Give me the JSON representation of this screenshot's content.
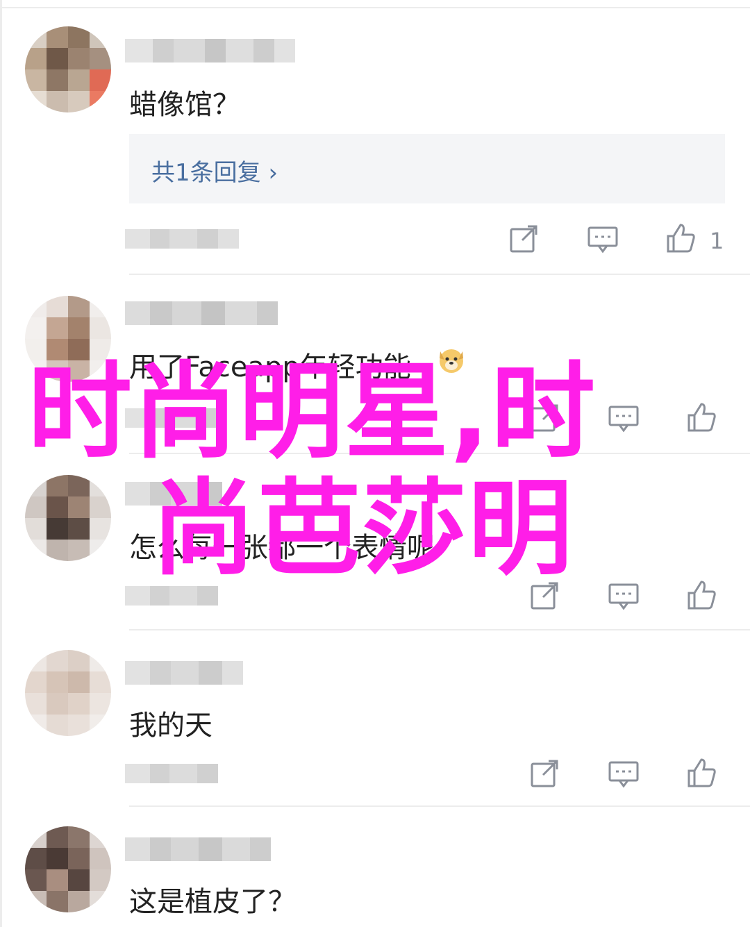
{
  "overlay": {
    "title_line1": "时尚明星,时",
    "title_line2": "尚芭莎明",
    "color": "#ff1ee8"
  },
  "comments": [
    {
      "text": "蜡像馆？",
      "reply_label": "共1条回复 ›",
      "like_count": "1"
    },
    {
      "text": "用了Faceapp年轻功能",
      "emoji": "dog-face-icon",
      "like_count": ""
    },
    {
      "text": "怎么每一张都一个表情呢",
      "like_count": ""
    },
    {
      "text": "我的天",
      "like_count": ""
    },
    {
      "text": "这是植皮了？",
      "like_count": ""
    }
  ],
  "icons": {
    "share": "share-icon",
    "reply": "comment-icon",
    "like": "thumbs-up-icon"
  },
  "colors": {
    "reply_link": "#4a6fa0",
    "icon_gray": "#8a8f99",
    "reply_bg": "#f4f5f7"
  }
}
